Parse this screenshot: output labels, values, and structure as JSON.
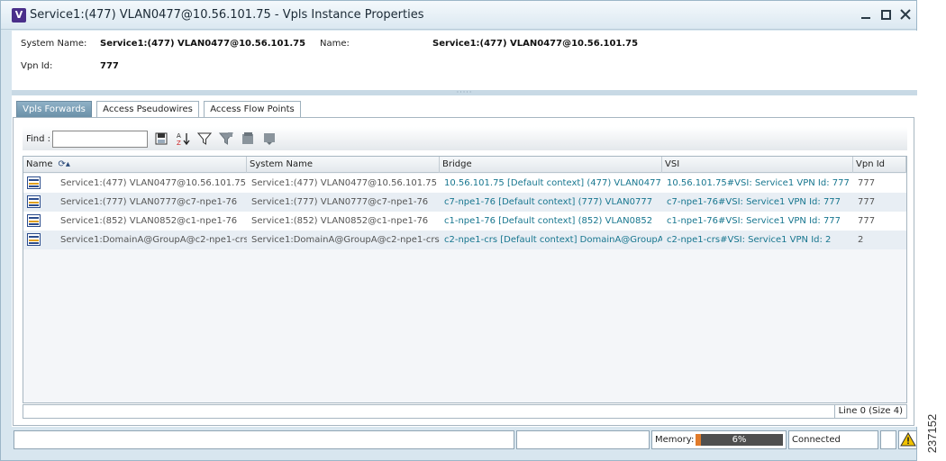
{
  "window": {
    "title": "Service1:(477) VLAN0477@10.56.101.75 - Vpls Instance Properties",
    "app_icon_letter": "V"
  },
  "properties": {
    "system_name_label": "System Name:",
    "system_name_value": "Service1:(477) VLAN0477@10.56.101.75",
    "name_label": "Name:",
    "name_value": "Service1:(477) VLAN0477@10.56.101.75",
    "vpn_id_label": "Vpn Id:",
    "vpn_id_value": "777"
  },
  "tabs": [
    {
      "label": "Vpls Forwards",
      "active": true
    },
    {
      "label": "Access Pseudowires",
      "active": false
    },
    {
      "label": "Access Flow Points",
      "active": false
    }
  ],
  "toolbar": {
    "find_label": "Find :",
    "find_value": "",
    "icons": [
      "export-icon",
      "sort-az-icon",
      "filter-icon",
      "advanced-filter-icon",
      "clear-filter-icon",
      "settings-filter-icon"
    ]
  },
  "table": {
    "columns": [
      "Name",
      "System Name",
      "Bridge",
      "VSI",
      "Vpn Id"
    ],
    "rows": [
      [
        "Service1:(477) VLAN0477@10.56.101.75",
        "Service1:(477) VLAN0477@10.56.101.75",
        "10.56.101.75 [Default context] (477) VLAN0477",
        "10.56.101.75#VSI: Service1 VPN Id: 777",
        "777"
      ],
      [
        "Service1:(777) VLAN0777@c7-npe1-76",
        "Service1:(777) VLAN0777@c7-npe1-76",
        "c7-npe1-76 [Default context] (777) VLAN0777",
        "c7-npe1-76#VSI: Service1 VPN Id: 777",
        "777"
      ],
      [
        "Service1:(852) VLAN0852@c1-npe1-76",
        "Service1:(852) VLAN0852@c1-npe1-76",
        "c1-npe1-76 [Default context] (852) VLAN0852",
        "c1-npe1-76#VSI: Service1 VPN Id: 777",
        "777"
      ],
      [
        "Service1:DomainA@GroupA@c2-npe1-crs",
        "Service1:DomainA@GroupA@c2-npe1-crs",
        "c2-npe1-crs [Default context] DomainA@GroupA",
        "c2-npe1-crs#VSI: Service1 VPN Id: 2",
        "2"
      ]
    ],
    "footer_status": "Line 0 (Size 4)"
  },
  "statusbar": {
    "memory_label": "Memory:",
    "memory_value": "6%",
    "memory_fraction": 0.06,
    "connection_status": "Connected"
  },
  "side_label": "237152",
  "colors": {
    "link": "#17768f",
    "tab_active": "#7a9db4",
    "memory_fill": "#e07a2a",
    "warning": "#f2c200"
  }
}
